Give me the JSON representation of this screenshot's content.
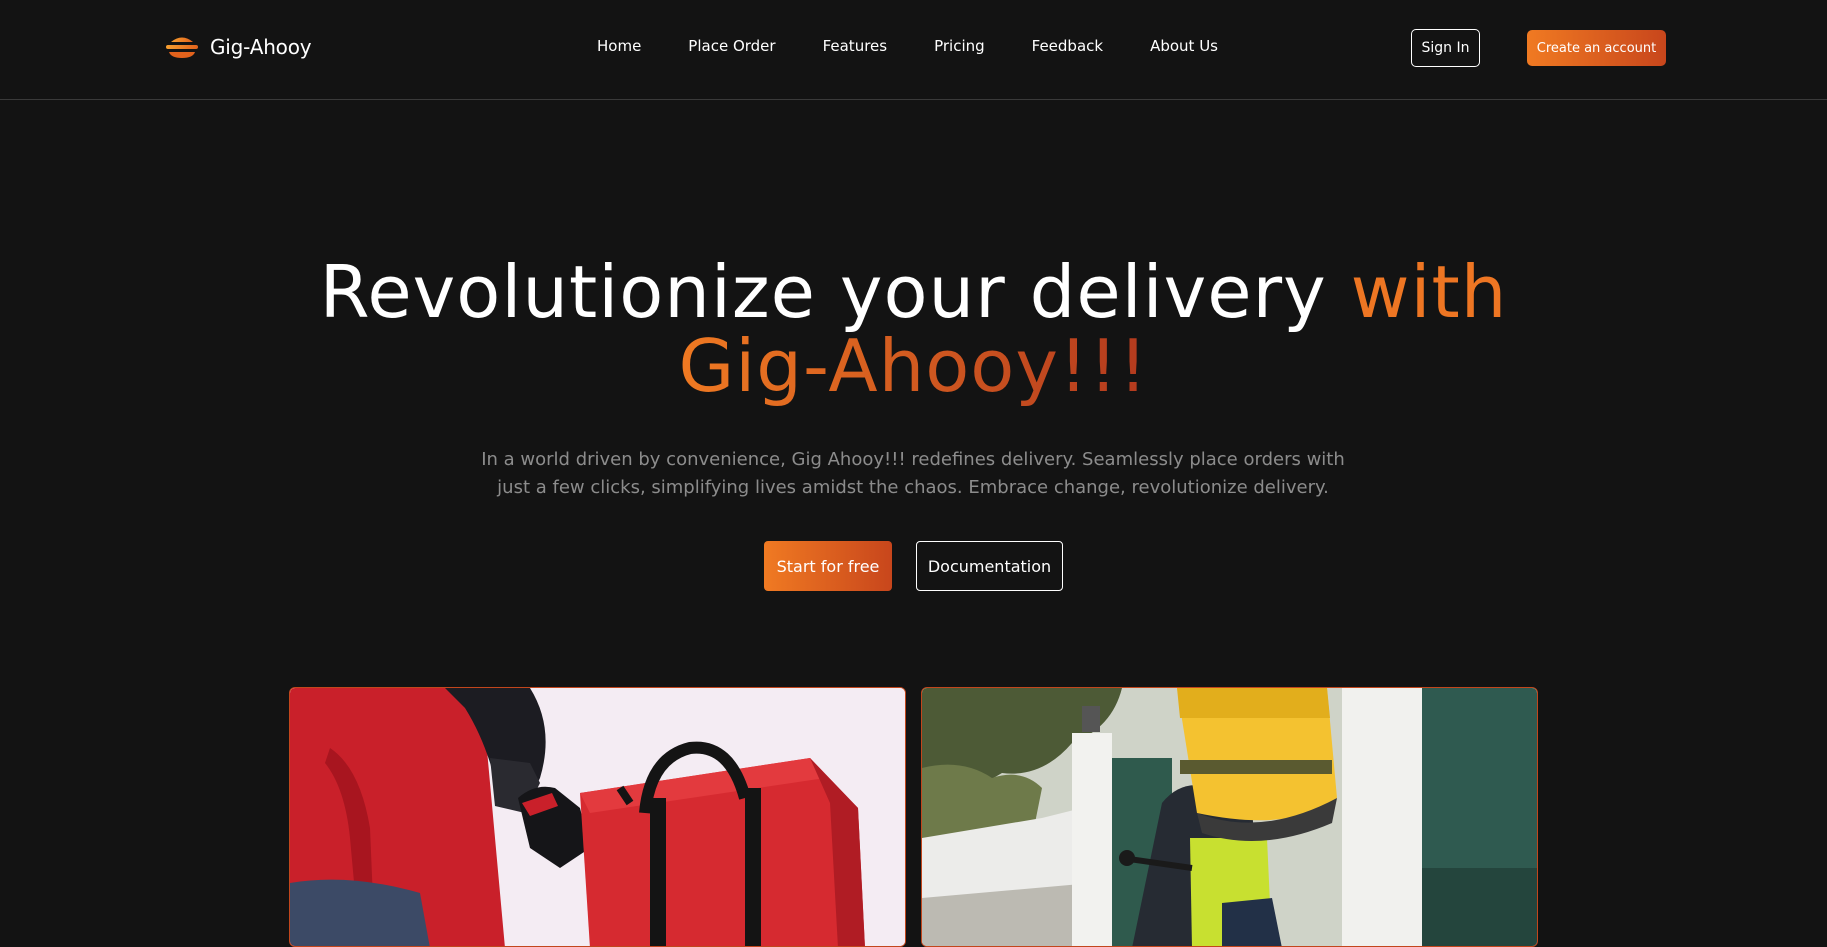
{
  "brand": {
    "name": "Gig-Ahooy",
    "logo_icon": "stacked-burger-logo-icon"
  },
  "nav": {
    "links": [
      "Home",
      "Place Order",
      "Features",
      "Pricing",
      "Feedback",
      "About Us"
    ]
  },
  "auth": {
    "sign_in_label": "Sign In",
    "create_account_label": "Create an account"
  },
  "hero": {
    "title_part1": "Revolutionize your delivery ",
    "title_accent_word": "with",
    "title_accent_line2": "Gig-Ahooy!!!",
    "subtitle": "In a world driven by convenience, Gig Ahooy!!! redefines delivery. Seamlessly place orders with just a few clicks, simplifying lives amidst the chaos. Embrace change, revolutionize delivery.",
    "cta_primary": "Start for free",
    "cta_secondary": "Documentation"
  },
  "gallery": {
    "images": [
      "delivery-courier-red-bag-image",
      "delivery-cyclist-yellow-backpack-image"
    ]
  },
  "colors": {
    "background": "#131313",
    "accent_start": "#f07a22",
    "accent_end": "#c8461c",
    "muted_text": "#8c8c8c"
  }
}
